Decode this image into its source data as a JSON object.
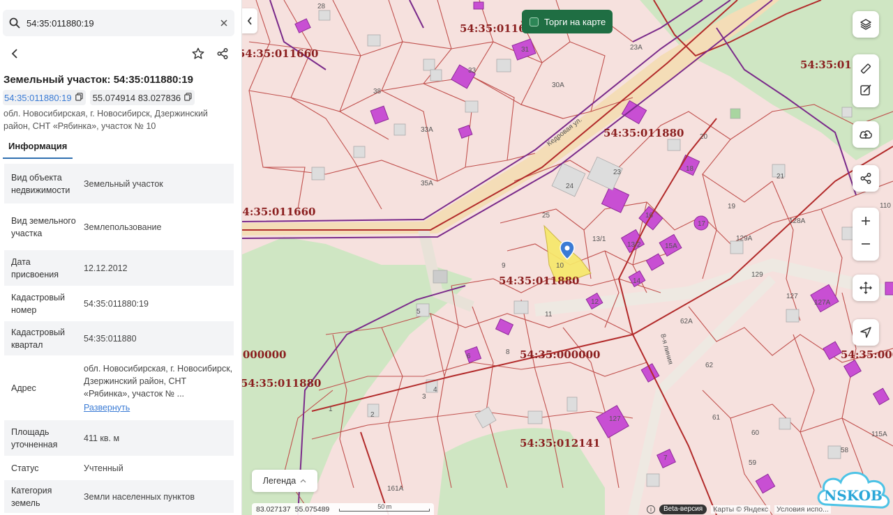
{
  "search": {
    "value": "54:35:011880:19"
  },
  "object": {
    "title": "Земельный участок: 54:35:011880:19",
    "cadastral_chip": "54:35:011880:19",
    "coords_chip": "55.074914 83.027836",
    "address": "обл. Новосибирская, г. Новосибирск, Дзержинский район, СНТ «Рябинка», участок № 10"
  },
  "tabs": {
    "info": "Информация"
  },
  "details": [
    {
      "key": "Вид объекта недвижимости",
      "value": "Земельный участок"
    },
    {
      "key": "Вид земельного участка",
      "value": "Землепользование"
    },
    {
      "key": "Дата присвоения",
      "value": "12.12.2012"
    },
    {
      "key": "Кадастровый номер",
      "value": "54:35:011880:19"
    },
    {
      "key": "Кадастровый квартал",
      "value": "54:35:011880"
    },
    {
      "key": "Адрес",
      "value": "обл. Новосибирская, г. Новосибирск, Дзержинский район, СНТ «Рябинка», участок № ...",
      "link": "Развернуть"
    },
    {
      "key": "Площадь уточненная",
      "value": "411 кв. м"
    },
    {
      "key": "Статус",
      "value": "Учтенный"
    },
    {
      "key": "Категория земель",
      "value": "Земли населенных пунктов"
    }
  ],
  "map": {
    "auction_label": "Торги на карте",
    "legend_label": "Легенда",
    "cursor_lon": "83.027137",
    "cursor_lat": "55.075489",
    "scale_label": "50 m",
    "beta_label": "Beta-версия",
    "attribution": "Карты © Яндекс",
    "terms": "Условия испо...",
    "watermark": "NSKOB",
    "quarter_labels": [
      "54:35:011880",
      "54:35:011660",
      "54:35:000000",
      "54:35:012141",
      "54:35:011880",
      "54:35:011660",
      "54:35:011880",
      "54:35:000000",
      "54:35:0116",
      "54:35:01",
      "54:35:0000"
    ],
    "road_label": "Кедровая ул.",
    "street_label": "8-я линия",
    "parcel_numbers": [
      "28",
      "31",
      "33",
      "38",
      "33А",
      "30А",
      "23А",
      "35А",
      "24",
      "23",
      "25",
      "20",
      "19",
      "21",
      "18",
      "17",
      "16",
      "15А",
      "13/1",
      "13/2",
      "14",
      "10",
      "9",
      "11",
      "12",
      "8",
      "5",
      "4",
      "3",
      "2",
      "1",
      "7",
      "62А",
      "62",
      "61",
      "60",
      "59",
      "58",
      "127",
      "127А",
      "128А",
      "129",
      "129А",
      "110",
      "115А",
      "127",
      "161А",
      "6"
    ]
  },
  "colors": {
    "accent": "#2f6fb0",
    "auction": "#1f6e43",
    "parcel_fill": "#f6e1de",
    "parcel_line": "#c0504d",
    "building": "#c84fd3",
    "selected": "#f7e86a"
  }
}
